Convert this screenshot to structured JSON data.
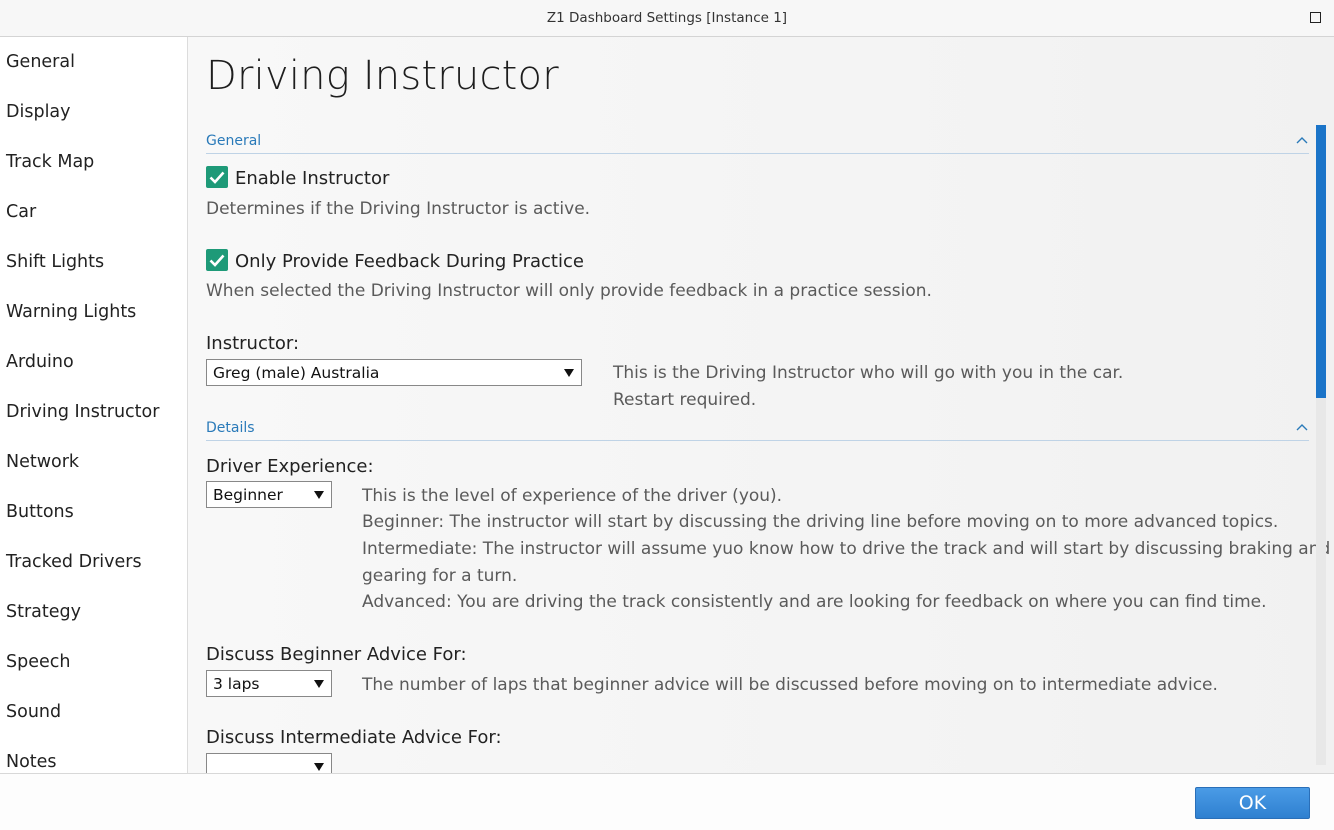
{
  "window": {
    "title": "Z1 Dashboard Settings [Instance 1]"
  },
  "sidebar": {
    "items": [
      {
        "label": "General"
      },
      {
        "label": "Display"
      },
      {
        "label": "Track Map"
      },
      {
        "label": "Car"
      },
      {
        "label": "Shift Lights"
      },
      {
        "label": "Warning Lights"
      },
      {
        "label": "Arduino"
      },
      {
        "label": "Driving Instructor"
      },
      {
        "label": "Network"
      },
      {
        "label": "Buttons"
      },
      {
        "label": "Tracked Drivers"
      },
      {
        "label": "Strategy"
      },
      {
        "label": "Speech"
      },
      {
        "label": "Sound"
      },
      {
        "label": "Notes"
      }
    ]
  },
  "page": {
    "title": "Driving Instructor",
    "general": {
      "header": "General",
      "enable_instructor": {
        "label": "Enable Instructor",
        "checked": true,
        "description": "Determines if the Driving Instructor is active."
      },
      "practice_only": {
        "label": "Only Provide Feedback During Practice",
        "checked": true,
        "description": "When selected the Driving Instructor will only provide feedback in a practice session."
      },
      "instructor": {
        "label": "Instructor:",
        "value": "Greg (male) Australia",
        "description_1": "This is the Driving Instructor who will go with you in the car.",
        "description_2": "Restart required."
      }
    },
    "details": {
      "header": "Details",
      "experience": {
        "label": "Driver Experience:",
        "value": "Beginner",
        "desc_1": "This is the level of experience of the driver (you).",
        "desc_2": "Beginner: The instructor will start by discussing the driving line before moving on to more advanced topics.",
        "desc_3": "Intermediate: The instructor will assume yuo know how to drive the track and will start by discussing braking and",
        "desc_4": "gearing for a turn.",
        "desc_5": "Advanced: You are driving the track consistently and are looking for feedback on where you can find time."
      },
      "beginner_advice": {
        "label": "Discuss Beginner Advice For:",
        "value": "3 laps",
        "description": "The number of laps that beginner advice will be discussed before moving on to intermediate advice."
      },
      "intermediate_advice": {
        "label": "Discuss Intermediate Advice For:"
      }
    }
  },
  "footer": {
    "ok_label": "OK"
  },
  "colors": {
    "accent": "#1b74c8",
    "checkbox": "#1e9a78",
    "section_header": "#2a7ab9"
  }
}
